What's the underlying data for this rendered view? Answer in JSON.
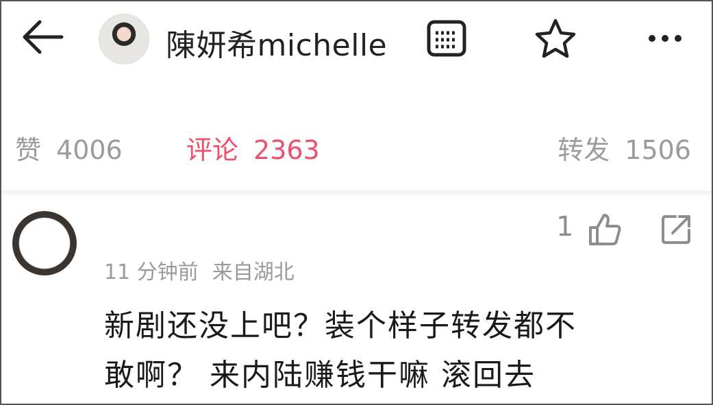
{
  "header": {
    "title": "陳妍希michelle",
    "icons": {
      "back": "back-arrow-icon",
      "doc": "document-icon",
      "star": "star-icon",
      "more": "more-icon"
    }
  },
  "stats": {
    "likes": {
      "label": "赞",
      "value": "4006"
    },
    "comments": {
      "label": "评论",
      "value": "2363"
    },
    "reposts": {
      "label": "转发",
      "value": "1506"
    },
    "colors": {
      "active": "#ef4f6b",
      "inactive": "#9b9b9b"
    }
  },
  "comment": {
    "like_count": "1",
    "time": "11 分钟前",
    "location": "来自湖北",
    "text_lines": [
      "新剧还没上吧？装个样子转发都不",
      "敢啊？  来内陆赚钱干嘛 滚回去"
    ]
  }
}
